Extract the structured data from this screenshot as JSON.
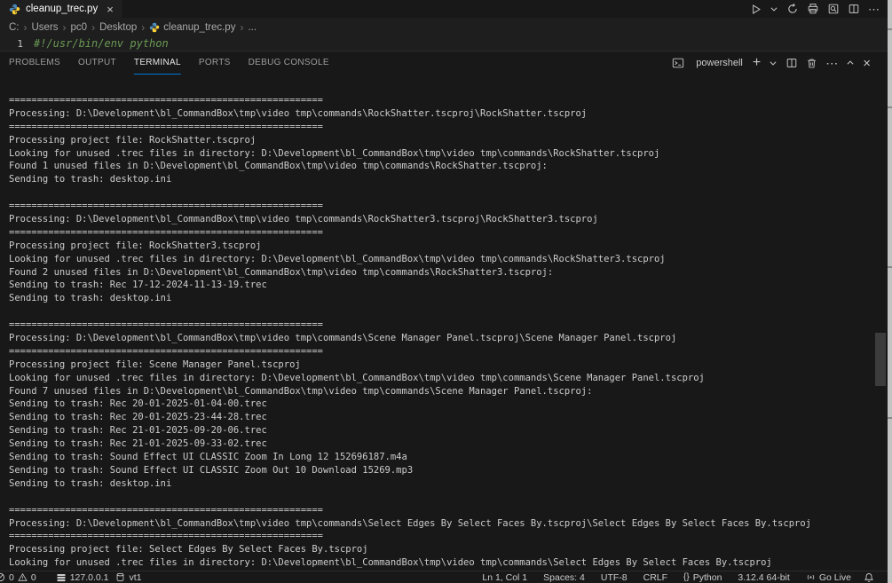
{
  "tab": {
    "label": "cleanup_trec.py"
  },
  "glyphs": {
    "close": "×",
    "plus": "+",
    "ellipsis": "⋯",
    "braces": "{}",
    "breadcrumb_sep": "›"
  },
  "breadcrumb": {
    "items": [
      "C:",
      "Users",
      "pc0",
      "Desktop",
      "cleanup_trec.py",
      "..."
    ]
  },
  "editor": {
    "line_number": "1",
    "code": "#!/usr/bin/env python"
  },
  "panel": {
    "tabs": [
      "PROBLEMS",
      "OUTPUT",
      "TERMINAL",
      "PORTS",
      "DEBUG CONSOLE"
    ],
    "active_tab": "TERMINAL",
    "toolbar": {
      "shell_label": "powershell"
    }
  },
  "terminal": {
    "lines": [
      "========================================================",
      "Processing: D:\\Development\\bl_CommandBox\\tmp\\video tmp\\commands\\RockShatter.tscproj\\RockShatter.tscproj",
      "========================================================",
      "Processing project file: RockShatter.tscproj",
      "Looking for unused .trec files in directory: D:\\Development\\bl_CommandBox\\tmp\\video tmp\\commands\\RockShatter.tscproj",
      "Found 1 unused files in D:\\Development\\bl_CommandBox\\tmp\\video tmp\\commands\\RockShatter.tscproj:",
      "Sending to trash: desktop.ini",
      "",
      "========================================================",
      "Processing: D:\\Development\\bl_CommandBox\\tmp\\video tmp\\commands\\RockShatter3.tscproj\\RockShatter3.tscproj",
      "========================================================",
      "Processing project file: RockShatter3.tscproj",
      "Looking for unused .trec files in directory: D:\\Development\\bl_CommandBox\\tmp\\video tmp\\commands\\RockShatter3.tscproj",
      "Found 2 unused files in D:\\Development\\bl_CommandBox\\tmp\\video tmp\\commands\\RockShatter3.tscproj:",
      "Sending to trash: Rec 17-12-2024-11-13-19.trec",
      "Sending to trash: desktop.ini",
      "",
      "========================================================",
      "Processing: D:\\Development\\bl_CommandBox\\tmp\\video tmp\\commands\\Scene Manager Panel.tscproj\\Scene Manager Panel.tscproj",
      "========================================================",
      "Processing project file: Scene Manager Panel.tscproj",
      "Looking for unused .trec files in directory: D:\\Development\\bl_CommandBox\\tmp\\video tmp\\commands\\Scene Manager Panel.tscproj",
      "Found 7 unused files in D:\\Development\\bl_CommandBox\\tmp\\video tmp\\commands\\Scene Manager Panel.tscproj:",
      "Sending to trash: Rec 20-01-2025-01-04-00.trec",
      "Sending to trash: Rec 20-01-2025-23-44-28.trec",
      "Sending to trash: Rec 21-01-2025-09-20-06.trec",
      "Sending to trash: Rec 21-01-2025-09-33-02.trec",
      "Sending to trash: Sound Effect UI CLASSIC Zoom In Long 12 152696187.m4a",
      "Sending to trash: Sound Effect UI CLASSIC Zoom Out 10 Download 15269.mp3",
      "Sending to trash: desktop.ini",
      "",
      "========================================================",
      "Processing: D:\\Development\\bl_CommandBox\\tmp\\video tmp\\commands\\Select Edges By Select Faces By.tscproj\\Select Edges By Select Faces By.tscproj",
      "========================================================",
      "Processing project file: Select Edges By Select Faces By.tscproj",
      "Looking for unused .trec files in directory: D:\\Development\\bl_CommandBox\\tmp\\video tmp\\commands\\Select Edges By Select Faces By.tscproj"
    ]
  },
  "status_bar": {
    "errors": "0",
    "warnings": "0",
    "remote": "127.0.0.1",
    "vt": "vt1",
    "cursor": "Ln 1, Col 1",
    "indent": "Spaces: 4",
    "encoding": "UTF-8",
    "eol": "CRLF",
    "language": "Python",
    "interpreter": "3.12.4 64-bit",
    "go_live": "Go Live"
  },
  "colors": {
    "accent": "#0078d4",
    "comment_green": "#6a9955",
    "python_blue": "#4b8bbe",
    "python_yellow": "#ffd43b",
    "panel_bg": "#181818",
    "editor_bg": "#1e1e1e"
  }
}
